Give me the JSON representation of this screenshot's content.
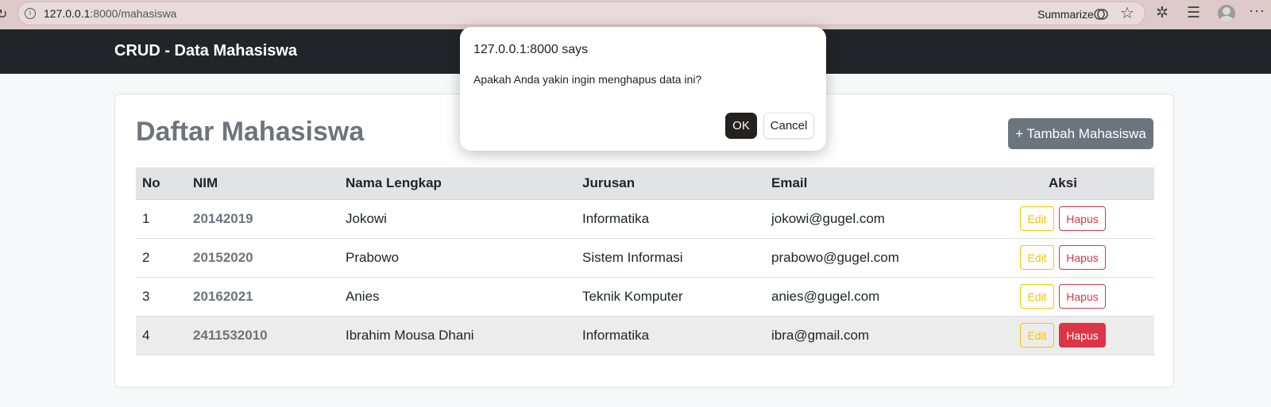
{
  "browser": {
    "url_host": "127.0.0.1",
    "url_rest": ":8000/mahasiswa",
    "summarize_label": "Summarize",
    "icons": [
      "reload-icon",
      "info-icon",
      "summarize-icon",
      "star-icon",
      "extensions-icon",
      "favorites-icon",
      "profile-avatar",
      "more-icon"
    ]
  },
  "navbar": {
    "brand": "CRUD - Data Mahasiswa"
  },
  "card": {
    "title": "Daftar Mahasiswa",
    "add_button": "+ Tambah Mahasiswa"
  },
  "table": {
    "headers": {
      "no": "No",
      "nim": "NIM",
      "nama": "Nama Lengkap",
      "jurusan": "Jurusan",
      "email": "Email",
      "aksi": "Aksi"
    },
    "rows": [
      {
        "no": "1",
        "nim": "20142019",
        "nama": "Jokowi",
        "jurusan": "Informatika",
        "email": "jokowi@gugel.com",
        "edit": "Edit",
        "hapus": "Hapus"
      },
      {
        "no": "2",
        "nim": "20152020",
        "nama": "Prabowo",
        "jurusan": "Sistem Informasi",
        "email": "prabowo@gugel.com",
        "edit": "Edit",
        "hapus": "Hapus"
      },
      {
        "no": "3",
        "nim": "20162021",
        "nama": "Anies",
        "jurusan": "Teknik Komputer",
        "email": "anies@gugel.com",
        "edit": "Edit",
        "hapus": "Hapus"
      },
      {
        "no": "4",
        "nim": "2411532010",
        "nama": "Ibrahim Mousa Dhani",
        "jurusan": "Informatika",
        "email": "ibra@gmail.com",
        "edit": "Edit",
        "hapus": "Hapus"
      }
    ]
  },
  "dialog": {
    "origin": "127.0.0.1:8000 says",
    "message": "Apakah Anda yakin ingin menghapus data ini?",
    "ok_label": "OK",
    "cancel_label": "Cancel"
  },
  "colors": {
    "navbar": "#212529",
    "secondary": "#6c757d",
    "warning": "#ffc107",
    "danger": "#dc3545"
  }
}
